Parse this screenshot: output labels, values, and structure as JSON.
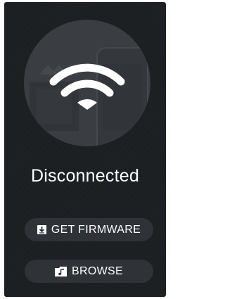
{
  "status": {
    "text": "Disconnected",
    "icon": "wifi-icon"
  },
  "buttons": {
    "firmware": {
      "label": "GET FIRMWARE",
      "icon": "download-icon"
    },
    "browse": {
      "label": "BROWSE",
      "icon": "music-folder-icon"
    }
  },
  "colors": {
    "background": "#1d2023",
    "circle": "#3a3e42",
    "button": "#2f3338",
    "text": "#ffffff"
  }
}
